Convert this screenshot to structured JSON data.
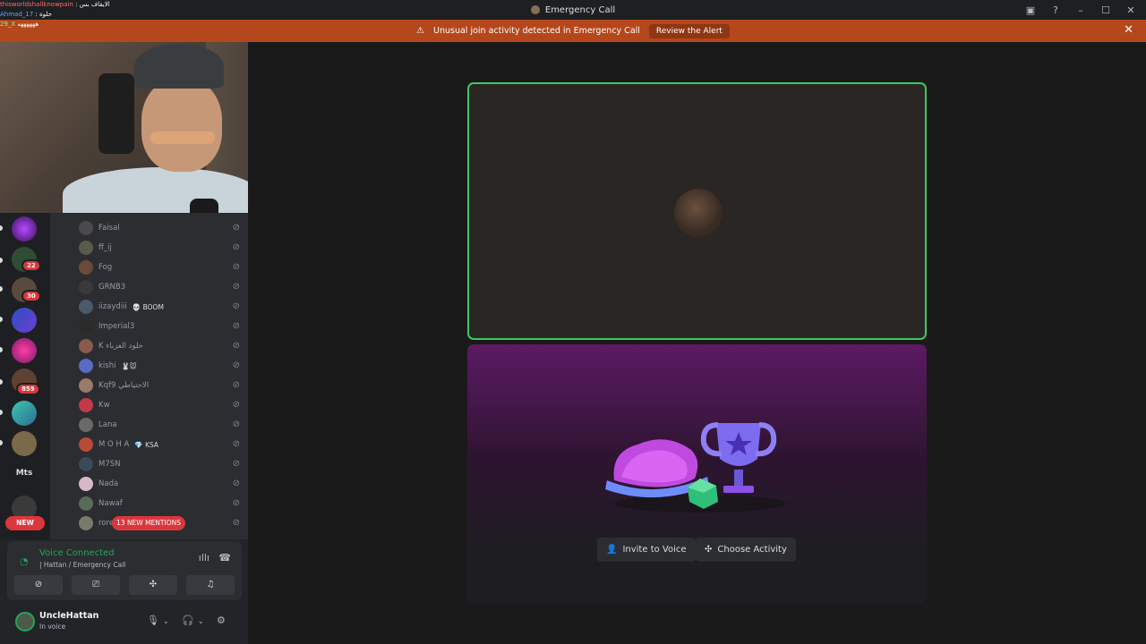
{
  "window": {
    "title": "Emergency Call"
  },
  "alert": {
    "message": "Unusual join activity detected in Emergency Call",
    "button": "Review the Alert"
  },
  "chat_overlay": [
    {
      "user": "thisworldshallknowpain",
      "text": ": الايقاف بس"
    },
    {
      "user": "Ahmad_17",
      "text": ": حلوة"
    },
    {
      "user": "29_X",
      "text": "ههههههه"
    }
  ],
  "servers": [
    {
      "badge": ""
    },
    {
      "badge": "22"
    },
    {
      "badge": "30"
    },
    {
      "badge": ""
    },
    {
      "badge": ""
    },
    {
      "badge": "859"
    },
    {
      "badge": ""
    },
    {
      "badge": ""
    },
    {
      "label": "Mts"
    },
    {
      "badge": ""
    }
  ],
  "new_pill": "NEW",
  "members": [
    {
      "name": "Faisal",
      "extra": ""
    },
    {
      "name": "ff_ij",
      "extra": ""
    },
    {
      "name": "Fog",
      "extra": ""
    },
    {
      "name": "GRNB3",
      "extra": ""
    },
    {
      "name": "iizaydiii",
      "extra": "💀 BOOM"
    },
    {
      "name": "Imperial3",
      "extra": ""
    },
    {
      "name": "K خلود العزباء",
      "extra": ""
    },
    {
      "name": "kishi",
      "extra": "🐰🐭"
    },
    {
      "name": "Kqf9 الاحتياطي",
      "extra": ""
    },
    {
      "name": "Kw",
      "extra": ""
    },
    {
      "name": "Lana",
      "extra": ""
    },
    {
      "name": "M O H A",
      "extra": "💎 KSA"
    },
    {
      "name": "M7SN",
      "extra": ""
    },
    {
      "name": "Nada",
      "extra": ""
    },
    {
      "name": "Nawaf",
      "extra": ""
    },
    {
      "name": "rore",
      "extra": ""
    }
  ],
  "mentions_pill": "13 NEW MENTIONS",
  "voice": {
    "status": "Voice Connected",
    "channel": "| Hattan / Emergency Call"
  },
  "user": {
    "name": "UncleHattan",
    "status": "In voice"
  },
  "actions": {
    "invite": "Invite to Voice",
    "activity": "Choose Activity"
  }
}
